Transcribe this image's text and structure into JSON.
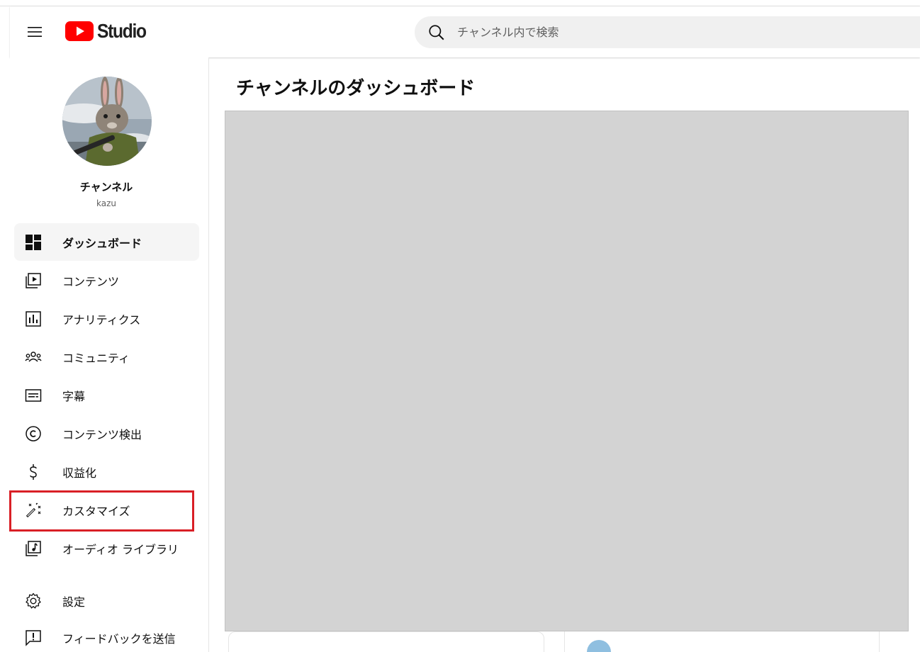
{
  "header": {
    "logo_text": "Studio",
    "search": {
      "placeholder": "チャンネル内で検索"
    }
  },
  "channel": {
    "name": "チャンネル",
    "handle": "kazu"
  },
  "sidebar": {
    "items": [
      {
        "label": "ダッシュボード",
        "icon": "dashboard-icon",
        "active": true
      },
      {
        "label": "コンテンツ",
        "icon": "content-icon"
      },
      {
        "label": "アナリティクス",
        "icon": "analytics-icon"
      },
      {
        "label": "コミュニティ",
        "icon": "community-icon"
      },
      {
        "label": "字幕",
        "icon": "subtitles-icon"
      },
      {
        "label": "コンテンツ検出",
        "icon": "copyright-icon"
      },
      {
        "label": "収益化",
        "icon": "monetization-icon"
      },
      {
        "label": "カスタマイズ",
        "icon": "magic-wand-icon",
        "highlighted": true
      },
      {
        "label": "オーディオ ライブラリ",
        "icon": "audio-library-icon"
      }
    ],
    "footer_items": [
      {
        "label": "設定",
        "icon": "gear-icon"
      },
      {
        "label": "フィードバックを送信",
        "icon": "feedback-icon"
      }
    ]
  },
  "main": {
    "title": "チャンネルのダッシュボード"
  },
  "colors": {
    "brand_red": "#ff0000",
    "highlight_border": "#d91f26",
    "placeholder_gray": "#d3d3d3"
  }
}
